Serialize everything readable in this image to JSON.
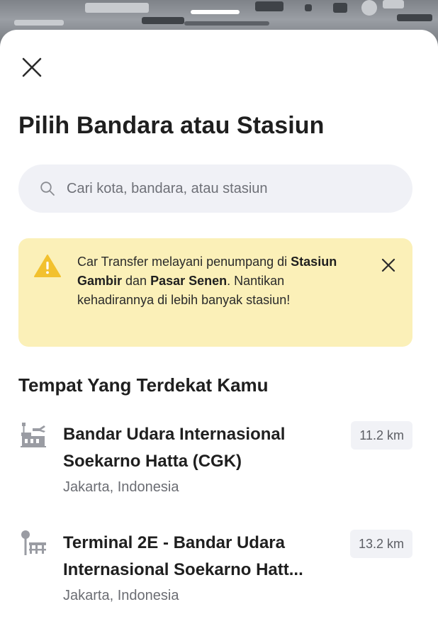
{
  "sheet": {
    "title": "Pilih Bandara atau Stasiun",
    "close_icon": "close-icon"
  },
  "search": {
    "placeholder": "Cari kota, bandara, atau stasiun",
    "value": "",
    "icon": "search-icon"
  },
  "notice": {
    "icon": "warning-icon",
    "text_before": "Car Transfer melayani penumpang di ",
    "station_1": "Stasiun Gambir",
    "text_between": " dan ",
    "station_2": "Pasar Senen",
    "text_after": ". Nantikan kehadirannya di lebih banyak stasiun!",
    "close_icon": "close-icon",
    "background_color": "#fbf0b8",
    "icon_color": "#f2c12e"
  },
  "nearby": {
    "title": "Tempat Yang Terdekat Kamu",
    "items": [
      {
        "icon": "airport-terminal-icon",
        "name_line_1": "Bandar Udara Internasional",
        "name_line_2": "Soekarno Hatta (CGK)",
        "location": "Jakarta, Indonesia",
        "distance": "11.2 km"
      },
      {
        "icon": "pickup-point-icon",
        "name_line_1": "Terminal 2E - Bandar Udara",
        "name_line_2": "Internasional Soekarno Hatt...",
        "location": "Jakarta, Indonesia",
        "distance": "13.2 km"
      }
    ]
  }
}
